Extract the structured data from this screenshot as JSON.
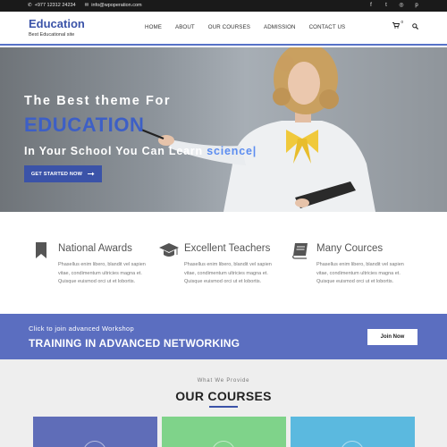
{
  "topbar": {
    "phone": "+977 12312 24234",
    "email": "info@wpoperation.com",
    "social": [
      {
        "icon": "facebook-icon",
        "glyph": "f"
      },
      {
        "icon": "twitter-icon",
        "glyph": "t"
      },
      {
        "icon": "instagram-icon",
        "glyph": "◎"
      },
      {
        "icon": "pinterest-icon",
        "glyph": "p"
      }
    ]
  },
  "header": {
    "brand_name": "Education",
    "brand_tagline": "Best Educational site",
    "nav": [
      "HOME",
      "ABOUT",
      "OUR COURSES",
      "ADMISSION",
      "CONTACT US"
    ],
    "cart_count": "0"
  },
  "hero": {
    "line1": "The Best theme For",
    "line2": "EDUCATION",
    "line3_prefix": "In Your School You Can Learn",
    "line3_word": "science|",
    "button_label": "GET STARTED NOW"
  },
  "features": [
    {
      "icon": "bookmark-icon",
      "title": "National Awards",
      "text": "Phasellus enim libero, blandit vel sapien vitae, condimentum ultricies magna et. Quisque euismod orci ut et lobortis."
    },
    {
      "icon": "graduation-cap-icon",
      "title": "Excellent Teachers",
      "text": "Phasellus enim libero, blandit vel sapien vitae, condimentum ultricies magna et. Quisque euismod orci ut et lobortis."
    },
    {
      "icon": "book-icon",
      "title": "Many Cources",
      "text": "Phasellus enim libero, blandit vel sapien vitae, condimentum ultricies magna et. Quisque euismod orci ut et lobortis."
    }
  ],
  "workshop": {
    "small": "Click to join advanced Workshop",
    "big": "TRAINING IN ADVANCED NETWORKING",
    "button_label": "Join Now"
  },
  "courses": {
    "pre_title": "What We Provide",
    "title": "OUR COURSES",
    "card_colors": [
      "#5f6db8",
      "#7fd38a",
      "#5bb9df"
    ]
  },
  "colors": {
    "brand": "#3b53a8",
    "band": "#5b6ec0",
    "hero_word": "#5c8df0"
  }
}
